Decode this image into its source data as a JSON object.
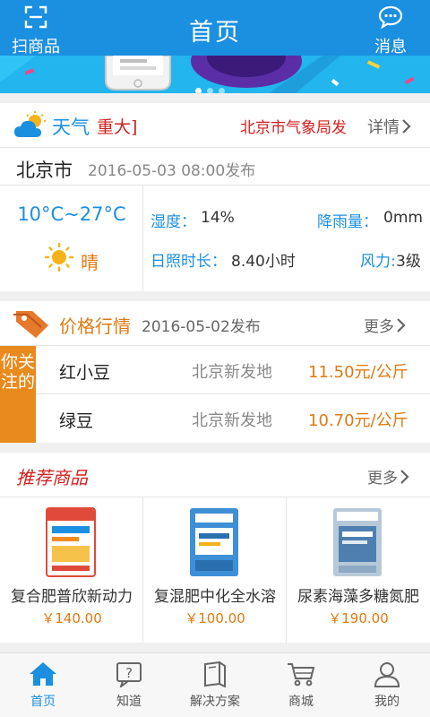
{
  "header": {
    "title": "首页",
    "scan_label": "扫商品",
    "message_label": "消息"
  },
  "banner": {
    "page_count": 3,
    "active_index": 0
  },
  "weather": {
    "title": "天气",
    "alert_tag": "重大]",
    "source": "北京市气象局发",
    "detail_label": "详情",
    "city": "北京市",
    "published": "2016-05-03 08:00发布",
    "temperature": "10°C~27°C",
    "condition": "晴",
    "humidity_label": "湿度：",
    "humidity_value": "14%",
    "rainfall_label": "降雨量：",
    "rainfall_value": "0mm",
    "sunshine_label": "日照时长：",
    "sunshine_value": "8.40小时",
    "wind_label": "风力:",
    "wind_value": "3级"
  },
  "price": {
    "title": "价格行情",
    "date": "2016-05-02发布",
    "more_label": "更多",
    "side_label": "你关注的",
    "rows": [
      {
        "name": "红小豆",
        "market": "北京新发地",
        "price": "11.50元/公斤"
      },
      {
        "name": "绿豆",
        "market": "北京新发地",
        "price": "10.70元/公斤"
      }
    ]
  },
  "recommended": {
    "title": "推荐商品",
    "more_label": "更多",
    "products": [
      {
        "name": "复合肥普欣新动力",
        "price": "￥140.00"
      },
      {
        "name": "复混肥中化全水溶",
        "price": "￥100.00"
      },
      {
        "name": "尿素海藻多糖氮肥",
        "price": "￥190.00"
      }
    ]
  },
  "tabs": [
    {
      "label": "首页",
      "icon": "home-icon",
      "active": true
    },
    {
      "label": "知道",
      "icon": "question-icon",
      "active": false
    },
    {
      "label": "解决方案",
      "icon": "book-icon",
      "active": false
    },
    {
      "label": "商城",
      "icon": "cart-icon",
      "active": false
    },
    {
      "label": "我的",
      "icon": "user-icon",
      "active": false
    }
  ],
  "colors": {
    "primary": "#1b8fe0",
    "accent": "#e07a10",
    "alert": "#d32020"
  }
}
